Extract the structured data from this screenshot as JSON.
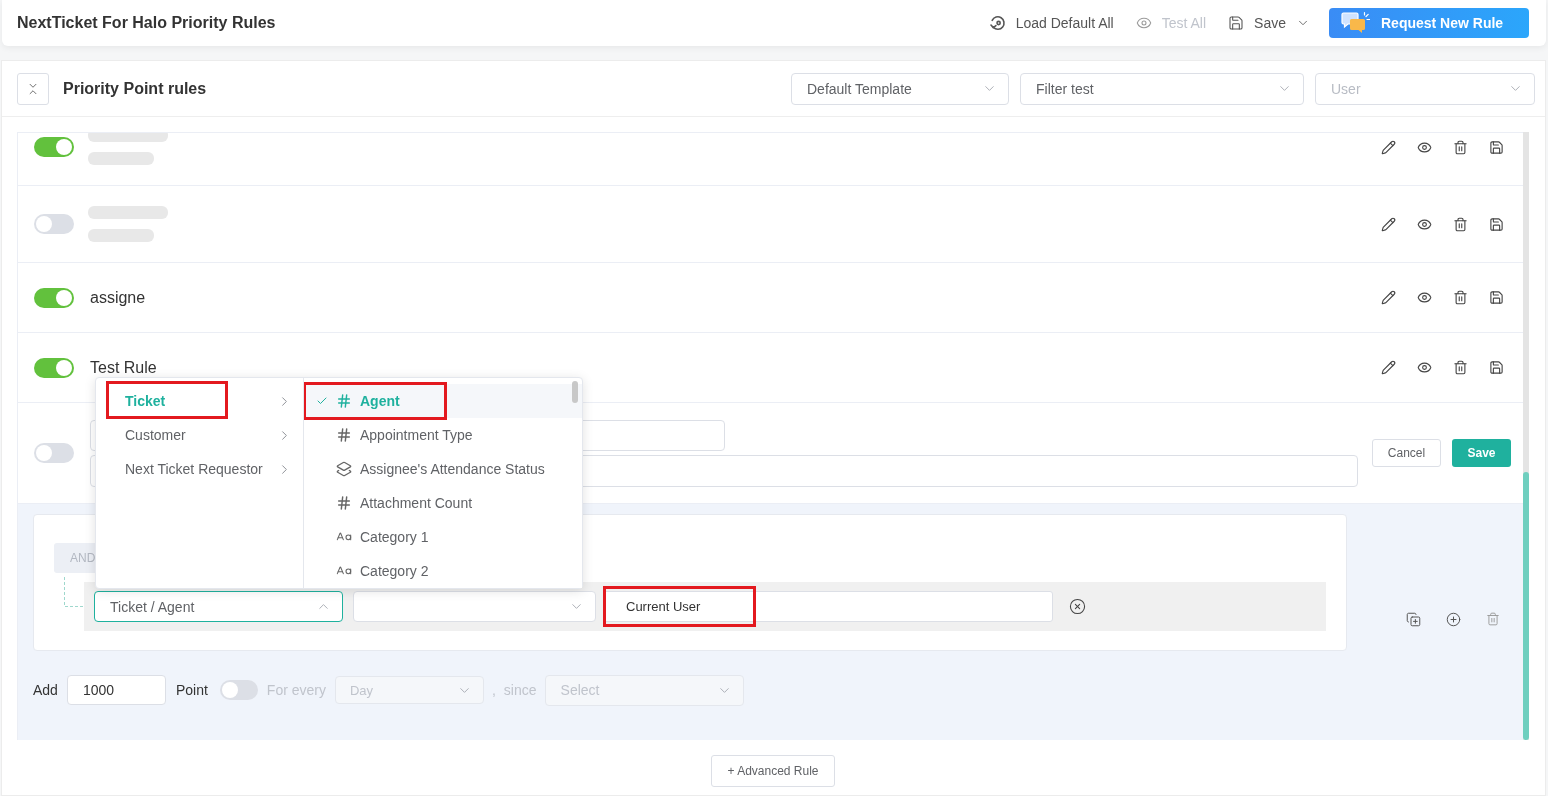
{
  "header": {
    "title": "NextTicket For Halo Priority Rules",
    "actions": [
      {
        "kind": "restore",
        "label": "Load Default All",
        "disabled": false,
        "has_menu": false
      },
      {
        "kind": "preview",
        "label": "Test All",
        "disabled": true,
        "has_menu": false
      },
      {
        "kind": "save",
        "label": "Save",
        "disabled": false,
        "has_menu": true
      }
    ],
    "request_button": "Request New Rule"
  },
  "panel": {
    "title": "Priority Point rules",
    "filters": [
      {
        "value": "Default Template"
      },
      {
        "value": "Filter test"
      },
      {
        "placeholder": "User"
      }
    ]
  },
  "rules": [
    {
      "kind": "blurred",
      "enabled": true
    },
    {
      "kind": "blurred",
      "enabled": false
    },
    {
      "kind": "named",
      "name": "assigne",
      "enabled": true
    },
    {
      "kind": "named",
      "name": "Test Rule",
      "enabled": true
    }
  ],
  "editor": {
    "enabled": false,
    "cancel_button": "Cancel",
    "save_button": "Save",
    "logic_button": "AND",
    "condition": {
      "field": "Ticket / Agent",
      "open": true,
      "value": "Current User",
      "value_highlighted": true,
      "cascader": {
        "categories": [
          {
            "label": "Ticket",
            "selected": true,
            "highlighted": true
          },
          {
            "label": "Customer",
            "selected": false,
            "highlighted": false
          },
          {
            "label": "Next Ticket Requestor",
            "selected": false,
            "highlighted": false
          }
        ],
        "fields": [
          {
            "kind": "number",
            "label": "Agent",
            "selected": true,
            "highlighted": true
          },
          {
            "kind": "number",
            "label": "Appointment Type",
            "selected": false,
            "highlighted": false
          },
          {
            "kind": "status",
            "label": "Assignee's Attendance Status",
            "selected": false,
            "highlighted": false
          },
          {
            "kind": "number",
            "label": "Attachment Count",
            "selected": false,
            "highlighted": false
          },
          {
            "kind": "text",
            "label": "Category 1",
            "selected": false,
            "highlighted": false
          },
          {
            "kind": "text",
            "label": "Category 2",
            "selected": false,
            "highlighted": false
          }
        ]
      }
    },
    "points": {
      "add_label": "Add",
      "amount": "1000",
      "point_label": "Point",
      "recurring": false,
      "every_label": "For every",
      "period": "Day",
      "separator": ",",
      "since_label": "since",
      "since_placeholder": "Select"
    }
  },
  "advanced_button": "+ Advanced Rule"
}
